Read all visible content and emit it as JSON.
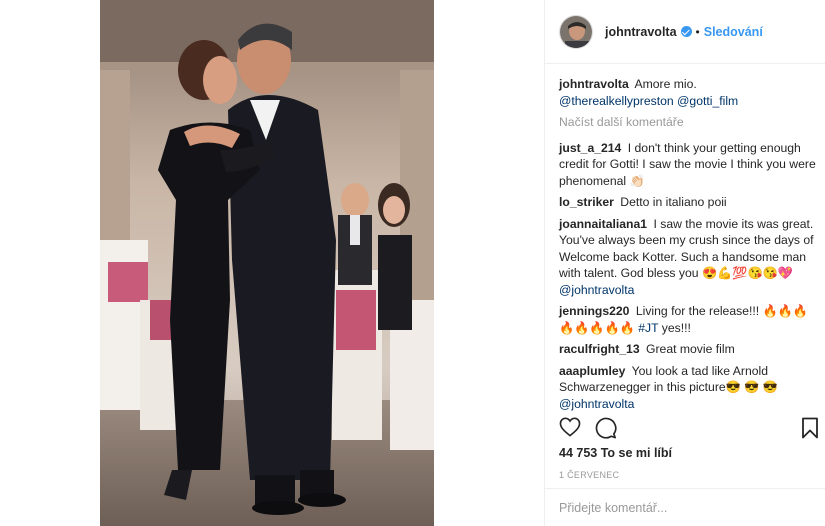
{
  "post": {
    "username": "johntravolta",
    "follow_label": "Sledování",
    "dot": "•"
  },
  "caption": {
    "username": "johntravolta",
    "text": "Amore mio.",
    "mentions": "@therealkellypreston @gotti_film"
  },
  "load_more_label": "Načíst další komentáře",
  "comments": [
    {
      "user": "just_a_214",
      "text": "I don't think your getting enough credit for Gotti! I saw the movie I think you were phenomenal 👏🏻"
    },
    {
      "user": "lo_striker",
      "text": "Detto in italiano poii"
    },
    {
      "user": "joannaitaliana1",
      "text": "I saw the movie its was great. You've always been my crush since the days of Welcome back Kotter. Such a handsome man with talent. God bless you 😍💪💯😘😘💖",
      "mention": "@johntravolta"
    },
    {
      "user": "jennings220",
      "text": "Living for the release!!! 🔥🔥🔥🔥🔥🔥🔥🔥",
      "mention": "#JT",
      "tail": "yes!!!"
    },
    {
      "user": "raculfright_13",
      "text": "Great movie film"
    },
    {
      "user": "aaaplumley",
      "text": "You look a tad like Arnold Schwarzenegger in this picture😎 😎 😎",
      "mention": "@johntravolta"
    }
  ],
  "likes_label": "44 753 To se mi líbí",
  "date_label": "1 ČERVENEC",
  "add_comment_placeholder": "Přidejte komentář...",
  "icons": [
    "heart-icon",
    "comment-icon",
    "bookmark-icon",
    "verified-badge-icon"
  ],
  "colors": {
    "link": "#3897f0",
    "mention": "#003569",
    "muted": "#999999"
  }
}
